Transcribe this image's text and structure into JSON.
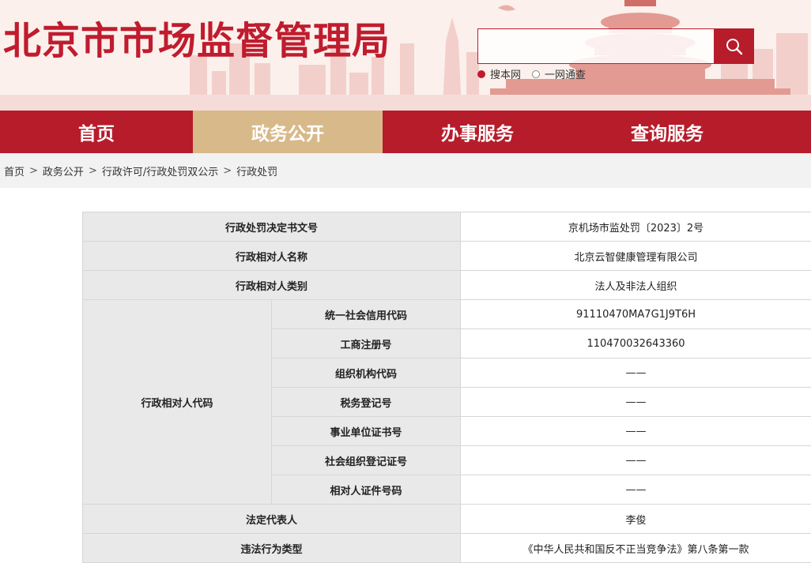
{
  "header": {
    "site_title": "北京市市场监督管理局",
    "search": {
      "placeholder": "",
      "button_icon": "search-icon",
      "options": [
        {
          "label": "搜本网",
          "selected": true
        },
        {
          "label": "一网通查",
          "selected": false
        }
      ]
    }
  },
  "nav": {
    "items": [
      {
        "label": "首页",
        "active": false
      },
      {
        "label": "政务公开",
        "active": true
      },
      {
        "label": "办事服务",
        "active": false
      },
      {
        "label": "查询服务",
        "active": false
      }
    ]
  },
  "breadcrumb": {
    "items": [
      "首页",
      "政务公开",
      "行政许可/行政处罚双公示",
      "行政处罚"
    ],
    "separator": ">"
  },
  "detail": {
    "rows": [
      {
        "label": "行政处罚决定书文号",
        "value": "京机场市监处罚〔2023〕2号"
      },
      {
        "label": "行政相对人名称",
        "value": "北京云智健康管理有限公司"
      },
      {
        "label": "行政相对人类别",
        "value": "法人及非法人组织"
      },
      {
        "label": "法定代表人",
        "value": "李俊"
      },
      {
        "label": "违法行为类型",
        "value": "《中华人民共和国反不正当竞争法》第八条第一款"
      }
    ],
    "code_group": {
      "label": "行政相对人代码",
      "rows": [
        {
          "label": "统一社会信用代码",
          "value": "91110470MA7G1J9T6H"
        },
        {
          "label": "工商注册号",
          "value": "110470032643360"
        },
        {
          "label": "组织机构代码",
          "value": "——"
        },
        {
          "label": "税务登记号",
          "value": "——"
        },
        {
          "label": "事业单位证书号",
          "value": "——"
        },
        {
          "label": "社会组织登记证号",
          "value": "——"
        },
        {
          "label": "相对人证件号码",
          "value": "——"
        }
      ]
    }
  },
  "colors": {
    "brand_red": "#b71c2b",
    "nav_active": "#d8b98a",
    "label_bg": "#e9e9e9"
  }
}
